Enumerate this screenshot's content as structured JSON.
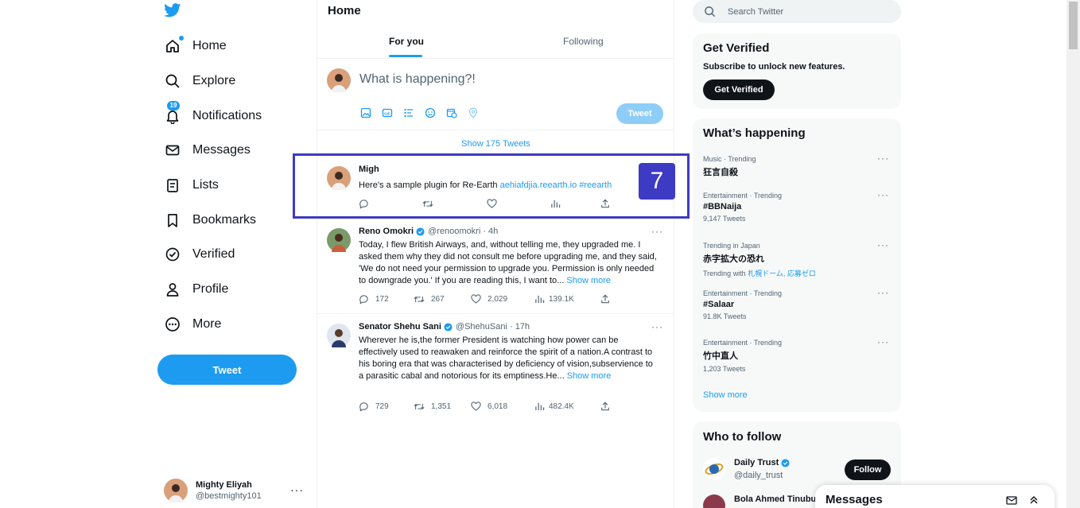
{
  "nav": {
    "items": [
      {
        "label": "Home",
        "icon": "home-icon"
      },
      {
        "label": "Explore",
        "icon": "search-icon"
      },
      {
        "label": "Notifications",
        "icon": "bell-icon",
        "badge": "19"
      },
      {
        "label": "Messages",
        "icon": "envelope-icon"
      },
      {
        "label": "Lists",
        "icon": "list-icon"
      },
      {
        "label": "Bookmarks",
        "icon": "bookmark-icon"
      },
      {
        "label": "Verified",
        "icon": "verified-icon"
      },
      {
        "label": "Profile",
        "icon": "person-icon"
      },
      {
        "label": "More",
        "icon": "more-circle-icon"
      }
    ],
    "tweet_button": "Tweet"
  },
  "account": {
    "name": "Mighty Eliyah",
    "handle": "@bestmighty101",
    "more": "···"
  },
  "main": {
    "title": "Home",
    "tabs": [
      {
        "label": "For you",
        "active": true
      },
      {
        "label": "Following",
        "active": false
      }
    ],
    "composer": {
      "placeholder": "What is happening?!",
      "button": "Tweet"
    },
    "show_tweets": "Show 175 Tweets",
    "tweets": [
      {
        "name": "Migh",
        "body": "Here's a sample plugin for Re-Earth ",
        "link": "aehiafdjia.reearth.io #reearth"
      },
      {
        "name": "Reno Omokri",
        "handle": "@renoomokri · 4h",
        "body": "Today, I flew British Airways, and, without telling me, they upgraded me. I asked them why they did not consult me before upgrading me, and they said, 'We do not need your permission to upgrade you. Permission is only needed to downgrade you.' If you are reading this, I want to... ",
        "show_more": "Show more",
        "counts": {
          "replies": "172",
          "retweets": "267",
          "likes": "2,029",
          "views": "139.1K"
        }
      },
      {
        "name": "Senator Shehu Sani",
        "handle": "@ShehuSani · 17h",
        "body": "Wherever he is,the former President is watching how power can be effectively used to reawaken and reinforce the spirit of a nation.A contrast to his boring era that was characterised by deficiency of vision,subservience to a parasitic cabal and notorious for its emptiness.He... ",
        "show_more": "Show more",
        "counts": {
          "replies": "729",
          "retweets": "1,351",
          "likes": "6,018",
          "views": "482.4K"
        }
      }
    ]
  },
  "step_marker": "7",
  "search": {
    "placeholder": "Search Twitter"
  },
  "verified_card": {
    "title": "Get Verified",
    "subtitle": "Subscribe to unlock new features.",
    "button": "Get Verified"
  },
  "trends": {
    "title": "What’s happening",
    "items": [
      {
        "meta": "Music · Trending",
        "name": "狂言自殺"
      },
      {
        "meta": "Entertainment · Trending",
        "name": "#BBNaija",
        "count": "9,147 Tweets"
      },
      {
        "meta": "Trending in Japan",
        "name": "赤字拡大の恐れ",
        "with_prefix": "Trending with ",
        "with": "札幌ドーム, 応募ゼロ"
      },
      {
        "meta": "Entertainment · Trending",
        "name": "#Salaar",
        "count": "91.8K Tweets"
      },
      {
        "meta": "Entertainment · Trending",
        "name": "竹中直人",
        "count": "1,203 Tweets"
      }
    ],
    "show_more": "Show more"
  },
  "who_to_follow": {
    "title": "Who to follow",
    "items": [
      {
        "name": "Daily Trust",
        "handle": "@daily_trust",
        "button": "Follow"
      },
      {
        "name": "Bola Ahmed Tinubu"
      }
    ]
  },
  "messages_dock": {
    "title": "Messages"
  },
  "colors": {
    "accent": "#1d9bf0",
    "highlight": "#3d3bc4",
    "text": "#0f1419",
    "muted": "#536471"
  }
}
